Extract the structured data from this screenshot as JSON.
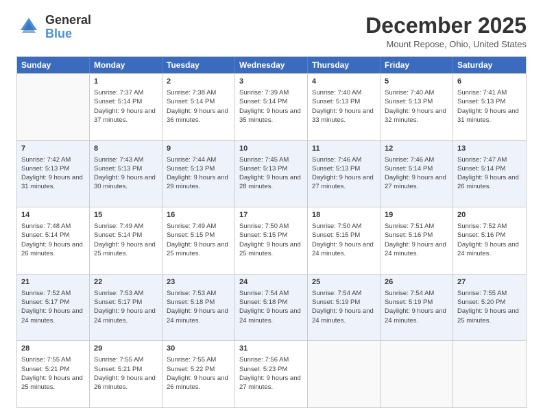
{
  "logo": {
    "general": "General",
    "blue": "Blue"
  },
  "header": {
    "month": "December 2025",
    "location": "Mount Repose, Ohio, United States"
  },
  "days": [
    "Sunday",
    "Monday",
    "Tuesday",
    "Wednesday",
    "Thursday",
    "Friday",
    "Saturday"
  ],
  "weeks": [
    [
      {
        "day": "",
        "empty": true
      },
      {
        "day": "1",
        "sunrise": "Sunrise: 7:37 AM",
        "sunset": "Sunset: 5:14 PM",
        "daylight": "Daylight: 9 hours and 37 minutes."
      },
      {
        "day": "2",
        "sunrise": "Sunrise: 7:38 AM",
        "sunset": "Sunset: 5:14 PM",
        "daylight": "Daylight: 9 hours and 36 minutes."
      },
      {
        "day": "3",
        "sunrise": "Sunrise: 7:39 AM",
        "sunset": "Sunset: 5:14 PM",
        "daylight": "Daylight: 9 hours and 35 minutes."
      },
      {
        "day": "4",
        "sunrise": "Sunrise: 7:40 AM",
        "sunset": "Sunset: 5:13 PM",
        "daylight": "Daylight: 9 hours and 33 minutes."
      },
      {
        "day": "5",
        "sunrise": "Sunrise: 7:40 AM",
        "sunset": "Sunset: 5:13 PM",
        "daylight": "Daylight: 9 hours and 32 minutes."
      },
      {
        "day": "6",
        "sunrise": "Sunrise: 7:41 AM",
        "sunset": "Sunset: 5:13 PM",
        "daylight": "Daylight: 9 hours and 31 minutes."
      }
    ],
    [
      {
        "day": "7",
        "sunrise": "Sunrise: 7:42 AM",
        "sunset": "Sunset: 5:13 PM",
        "daylight": "Daylight: 9 hours and 31 minutes."
      },
      {
        "day": "8",
        "sunrise": "Sunrise: 7:43 AM",
        "sunset": "Sunset: 5:13 PM",
        "daylight": "Daylight: 9 hours and 30 minutes."
      },
      {
        "day": "9",
        "sunrise": "Sunrise: 7:44 AM",
        "sunset": "Sunset: 5:13 PM",
        "daylight": "Daylight: 9 hours and 29 minutes."
      },
      {
        "day": "10",
        "sunrise": "Sunrise: 7:45 AM",
        "sunset": "Sunset: 5:13 PM",
        "daylight": "Daylight: 9 hours and 28 minutes."
      },
      {
        "day": "11",
        "sunrise": "Sunrise: 7:46 AM",
        "sunset": "Sunset: 5:13 PM",
        "daylight": "Daylight: 9 hours and 27 minutes."
      },
      {
        "day": "12",
        "sunrise": "Sunrise: 7:46 AM",
        "sunset": "Sunset: 5:14 PM",
        "daylight": "Daylight: 9 hours and 27 minutes."
      },
      {
        "day": "13",
        "sunrise": "Sunrise: 7:47 AM",
        "sunset": "Sunset: 5:14 PM",
        "daylight": "Daylight: 9 hours and 26 minutes."
      }
    ],
    [
      {
        "day": "14",
        "sunrise": "Sunrise: 7:48 AM",
        "sunset": "Sunset: 5:14 PM",
        "daylight": "Daylight: 9 hours and 26 minutes."
      },
      {
        "day": "15",
        "sunrise": "Sunrise: 7:49 AM",
        "sunset": "Sunset: 5:14 PM",
        "daylight": "Daylight: 9 hours and 25 minutes."
      },
      {
        "day": "16",
        "sunrise": "Sunrise: 7:49 AM",
        "sunset": "Sunset: 5:15 PM",
        "daylight": "Daylight: 9 hours and 25 minutes."
      },
      {
        "day": "17",
        "sunrise": "Sunrise: 7:50 AM",
        "sunset": "Sunset: 5:15 PM",
        "daylight": "Daylight: 9 hours and 25 minutes."
      },
      {
        "day": "18",
        "sunrise": "Sunrise: 7:50 AM",
        "sunset": "Sunset: 5:15 PM",
        "daylight": "Daylight: 9 hours and 24 minutes."
      },
      {
        "day": "19",
        "sunrise": "Sunrise: 7:51 AM",
        "sunset": "Sunset: 5:16 PM",
        "daylight": "Daylight: 9 hours and 24 minutes."
      },
      {
        "day": "20",
        "sunrise": "Sunrise: 7:52 AM",
        "sunset": "Sunset: 5:16 PM",
        "daylight": "Daylight: 9 hours and 24 minutes."
      }
    ],
    [
      {
        "day": "21",
        "sunrise": "Sunrise: 7:52 AM",
        "sunset": "Sunset: 5:17 PM",
        "daylight": "Daylight: 9 hours and 24 minutes."
      },
      {
        "day": "22",
        "sunrise": "Sunrise: 7:53 AM",
        "sunset": "Sunset: 5:17 PM",
        "daylight": "Daylight: 9 hours and 24 minutes."
      },
      {
        "day": "23",
        "sunrise": "Sunrise: 7:53 AM",
        "sunset": "Sunset: 5:18 PM",
        "daylight": "Daylight: 9 hours and 24 minutes."
      },
      {
        "day": "24",
        "sunrise": "Sunrise: 7:54 AM",
        "sunset": "Sunset: 5:18 PM",
        "daylight": "Daylight: 9 hours and 24 minutes."
      },
      {
        "day": "25",
        "sunrise": "Sunrise: 7:54 AM",
        "sunset": "Sunset: 5:19 PM",
        "daylight": "Daylight: 9 hours and 24 minutes."
      },
      {
        "day": "26",
        "sunrise": "Sunrise: 7:54 AM",
        "sunset": "Sunset: 5:19 PM",
        "daylight": "Daylight: 9 hours and 24 minutes."
      },
      {
        "day": "27",
        "sunrise": "Sunrise: 7:55 AM",
        "sunset": "Sunset: 5:20 PM",
        "daylight": "Daylight: 9 hours and 25 minutes."
      }
    ],
    [
      {
        "day": "28",
        "sunrise": "Sunrise: 7:55 AM",
        "sunset": "Sunset: 5:21 PM",
        "daylight": "Daylight: 9 hours and 25 minutes."
      },
      {
        "day": "29",
        "sunrise": "Sunrise: 7:55 AM",
        "sunset": "Sunset: 5:21 PM",
        "daylight": "Daylight: 9 hours and 26 minutes."
      },
      {
        "day": "30",
        "sunrise": "Sunrise: 7:55 AM",
        "sunset": "Sunset: 5:22 PM",
        "daylight": "Daylight: 9 hours and 26 minutes."
      },
      {
        "day": "31",
        "sunrise": "Sunrise: 7:56 AM",
        "sunset": "Sunset: 5:23 PM",
        "daylight": "Daylight: 9 hours and 27 minutes."
      },
      {
        "day": "",
        "empty": true
      },
      {
        "day": "",
        "empty": true
      },
      {
        "day": "",
        "empty": true
      }
    ]
  ]
}
